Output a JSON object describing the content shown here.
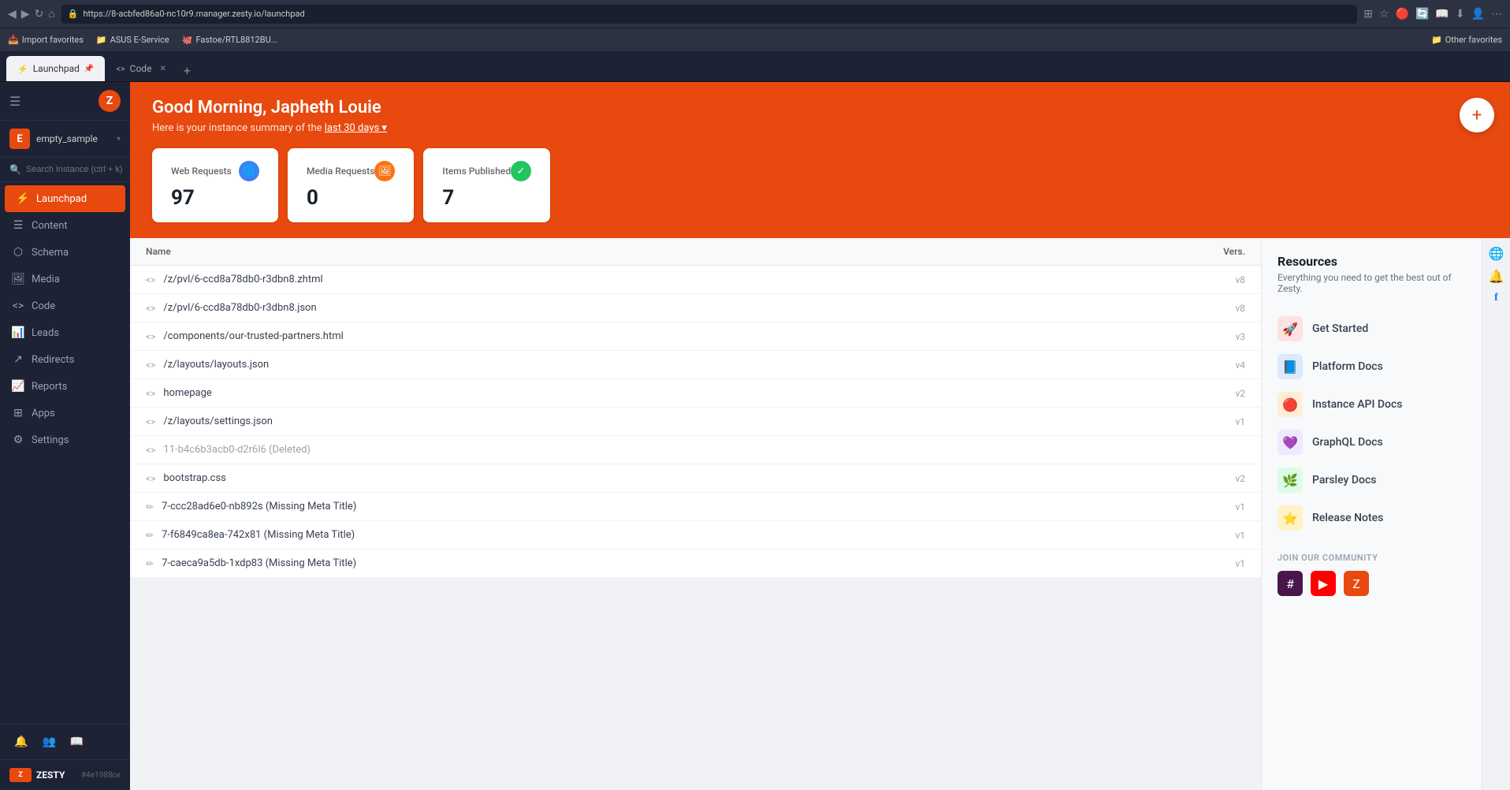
{
  "browser": {
    "url": "https://8-acbfed86a0-nc10r9.manager.zesty.io/launchpad",
    "back_icon": "◀",
    "forward_icon": "▶",
    "reload_icon": "↻",
    "home_icon": "⌂",
    "bookmark_icon": "☆",
    "tabs": [
      {
        "id": "launchpad",
        "label": "Launchpad",
        "icon": "⚡",
        "active": true
      },
      {
        "id": "code",
        "label": "Code",
        "icon": "<>",
        "active": false
      }
    ]
  },
  "bookmarks": [
    {
      "label": "Import favorites",
      "icon": "📥"
    },
    {
      "label": "ASUS E-Service",
      "icon": "📁",
      "folder": true
    },
    {
      "label": "Fastoe/RTL8812BU...",
      "icon": "🐙"
    },
    {
      "label": "Other favorites",
      "icon": "📁",
      "folder": true,
      "right": true
    }
  ],
  "sidebar": {
    "logo": "Z",
    "instance": {
      "avatar": "E",
      "name": "empty_sample",
      "chevron": "▾"
    },
    "search": {
      "placeholder": "Search Instance (ctrl + k)",
      "shortcut": "ctrl + k"
    },
    "nav_items": [
      {
        "id": "launchpad",
        "label": "Launchpad",
        "icon": "⚡",
        "active": true
      },
      {
        "id": "content",
        "label": "Content",
        "icon": "☰"
      },
      {
        "id": "schema",
        "label": "Schema",
        "icon": "⬡"
      },
      {
        "id": "media",
        "label": "Media",
        "icon": "🖼"
      },
      {
        "id": "code",
        "label": "Code",
        "icon": "<>"
      },
      {
        "id": "leads",
        "label": "Leads",
        "icon": "📊"
      },
      {
        "id": "redirects",
        "label": "Redirects",
        "icon": "↗"
      },
      {
        "id": "reports",
        "label": "Reports",
        "icon": "📈"
      },
      {
        "id": "apps",
        "label": "Apps",
        "icon": "⊞"
      },
      {
        "id": "settings",
        "label": "Settings",
        "icon": "⚙"
      }
    ],
    "footer": {
      "logo_text": "ZESTY",
      "instance_hash": "#4e1988ce"
    },
    "bottom_icons": [
      {
        "id": "notifications",
        "icon": "🔔"
      },
      {
        "id": "users",
        "icon": "👥"
      },
      {
        "id": "docs",
        "icon": "📖"
      }
    ]
  },
  "banner": {
    "greeting": "Good Morning, Japheth Louie",
    "subtitle_prefix": "Here is your instance summary of the",
    "subtitle_link": "last 30 days",
    "subtitle_suffix": " ▾",
    "plus_icon": "+"
  },
  "stats": [
    {
      "id": "web-requests",
      "label": "Web Requests",
      "value": "97",
      "icon": "🌐",
      "icon_class": "blue"
    },
    {
      "id": "media-requests",
      "label": "Media Requests",
      "value": "0",
      "icon": "🖼",
      "icon_class": "orange"
    },
    {
      "id": "items-published",
      "label": "Items Published",
      "value": "7",
      "icon": "✓",
      "icon_class": "green"
    }
  ],
  "file_table": {
    "columns": [
      {
        "id": "name",
        "label": "Name"
      },
      {
        "id": "vers",
        "label": "Vers."
      }
    ],
    "rows": [
      {
        "id": "row1",
        "name": "/z/pvl/6-ccd8a78db0-r3dbn8.zhtml",
        "vers": "v8",
        "type": "code"
      },
      {
        "id": "row2",
        "name": "/z/pvl/6-ccd8a78db0-r3dbn8.json",
        "vers": "v8",
        "type": "code"
      },
      {
        "id": "row3",
        "name": "/components/our-trusted-partners.html",
        "vers": "v3",
        "type": "code"
      },
      {
        "id": "row4",
        "name": "/z/layouts/layouts.json",
        "vers": "v4",
        "type": "code"
      },
      {
        "id": "row5",
        "name": "homepage",
        "vers": "v2",
        "type": "code"
      },
      {
        "id": "row6",
        "name": "/z/layouts/settings.json",
        "vers": "v1",
        "type": "code"
      },
      {
        "id": "row7",
        "name": "11-b4c6b3acb0-d2r6l6 (Deleted)",
        "vers": "",
        "type": "code",
        "deleted": true
      },
      {
        "id": "row8",
        "name": "bootstrap.css",
        "vers": "v2",
        "type": "code"
      },
      {
        "id": "row9",
        "name": "7-ccc28ad6e0-nb892s (Missing Meta Title)",
        "vers": "v1",
        "type": "edit"
      },
      {
        "id": "row10",
        "name": "7-f6849ca8ea-742x81 (Missing Meta Title)",
        "vers": "v1",
        "type": "edit"
      },
      {
        "id": "row11",
        "name": "7-caeca9a5db-1xdp83 (Missing Meta Title)",
        "vers": "v1",
        "type": "edit"
      }
    ]
  },
  "resources": {
    "title": "Resources",
    "subtitle": "Everything you need to get the best out of Zesty.",
    "items": [
      {
        "id": "get-started",
        "label": "Get Started",
        "icon": "🚀",
        "icon_class": "red"
      },
      {
        "id": "platform-docs",
        "label": "Platform Docs",
        "icon": "📘",
        "icon_class": "blue"
      },
      {
        "id": "instance-api-docs",
        "label": "Instance API Docs",
        "icon": "🔴",
        "icon_class": "orange"
      },
      {
        "id": "graphql-docs",
        "label": "GraphQL Docs",
        "icon": "💜",
        "icon_class": "purple"
      },
      {
        "id": "parsley-docs",
        "label": "Parsley Docs",
        "icon": "🌿",
        "icon_class": "green"
      },
      {
        "id": "release-notes",
        "label": "Release Notes",
        "icon": "⭐",
        "icon_class": "yellow"
      }
    ],
    "community": {
      "label": "JOIN OUR COMMUNITY",
      "icons": [
        {
          "id": "slack",
          "icon": "#",
          "class": "slack"
        },
        {
          "id": "youtube",
          "icon": "▶",
          "class": "youtube"
        },
        {
          "id": "blog",
          "icon": "Z",
          "class": "blog"
        }
      ]
    }
  },
  "right_bar": {
    "icons": [
      {
        "id": "globe",
        "icon": "🌐"
      },
      {
        "id": "bell",
        "icon": "🔔"
      },
      {
        "id": "facebook",
        "icon": "f",
        "class": "fb"
      }
    ]
  }
}
